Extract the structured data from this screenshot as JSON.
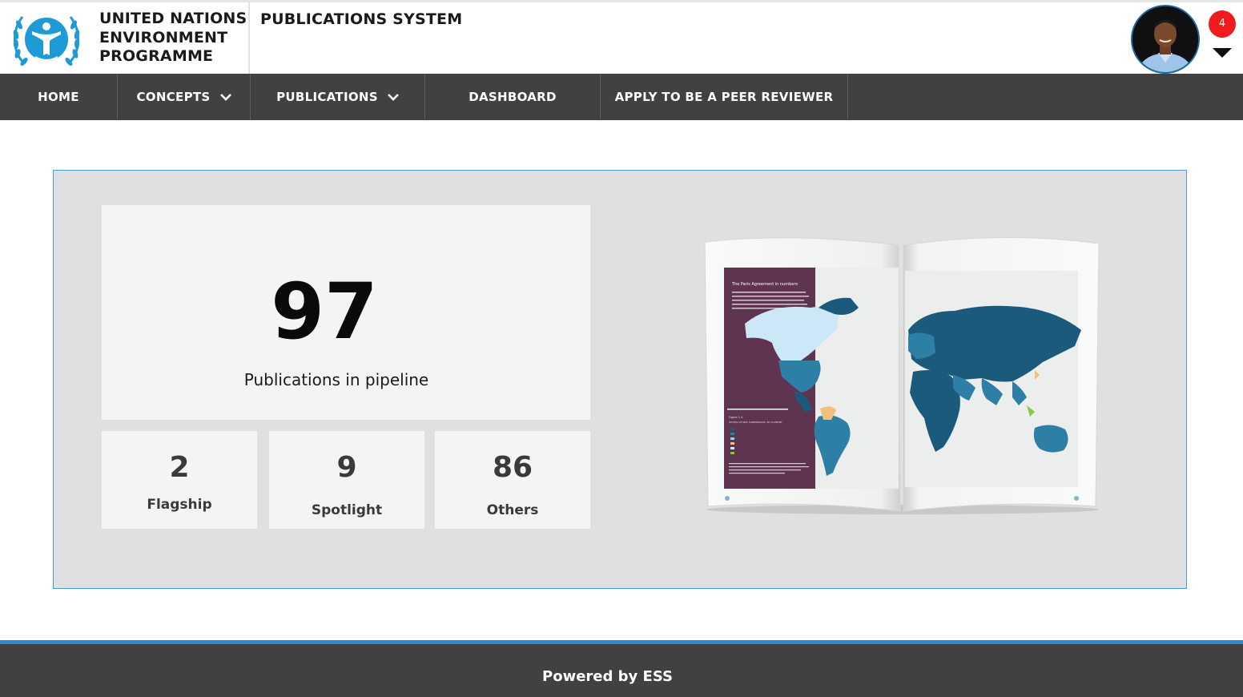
{
  "header": {
    "org_name_lines": [
      "UNITED NATIONS",
      "ENVIRONMENT",
      "PROGRAMME"
    ],
    "system_title": "PUBLICATIONS SYSTEM",
    "logo_icon": "unep-logo-icon",
    "avatar_icon": "user-avatar",
    "notification_count": "4",
    "notification_color": "#ee1c1c",
    "menu_icon": "caret-down-icon"
  },
  "nav": {
    "background": "#414141",
    "items": [
      {
        "label": "HOME",
        "dropdown": false
      },
      {
        "label": "CONCEPTS",
        "dropdown": true
      },
      {
        "label": "PUBLICATIONS",
        "dropdown": true
      },
      {
        "label": "DASHBOARD",
        "dropdown": false
      },
      {
        "label": "APPLY TO BE A PEER REVIEWER",
        "dropdown": false
      }
    ]
  },
  "dashboard": {
    "total": {
      "value": "97",
      "label": "Publications in pipeline"
    },
    "breakdown": [
      {
        "value": "2",
        "label": "Flagship"
      },
      {
        "value": "9",
        "label": "Spotlight"
      },
      {
        "value": "86",
        "label": "Others"
      }
    ],
    "image": {
      "icon": "open-book-world-map-image",
      "page_heading": "The Paris Agreement in numbers",
      "figure_label": "Figure 1.4",
      "figure_caption": "STATUS OF NDC SUBMISSIONS, BY COUNTRY"
    }
  },
  "footer": {
    "text": "Powered by ESS",
    "accent": "#2a8ad4"
  }
}
